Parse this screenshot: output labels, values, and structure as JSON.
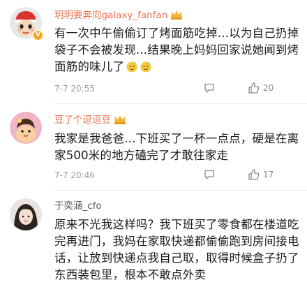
{
  "comments": [
    {
      "username": "玥玥要奔向galaxy_fanfan",
      "text": "有一次中午偷偷订了烤面筋吃掉...以为自己扔掉袋子不会被发现...结果晚上妈妈回家说她闻到烤面筋的味儿了",
      "time": "7-7 20:55",
      "likes": "20",
      "emoji": "sweat-smile-icon",
      "verified": true
    },
    {
      "username": "豆了个逗逗豆",
      "text": "我家是我爸爸...下班买了一杯一点点，硬是在离家500米的地方磕完了才敢往家走",
      "time": "7-7 20:46",
      "likes": "17",
      "verified": false
    },
    {
      "username": "于奕涵_cfo",
      "text": "原来不光我这样吗？我下班买了零食都在楼道吃完再进门，我妈在家取快递都偷偷跑到房间接电话，让放到快递点我自己取，取得时候盒子扔了东西装包里，根本不敢点外卖"
    }
  ],
  "colors": {
    "username_accent": "#eb7350",
    "username_plain": "#555555",
    "meta": "#9a9a9a",
    "verified_badge": "#f5a623"
  }
}
